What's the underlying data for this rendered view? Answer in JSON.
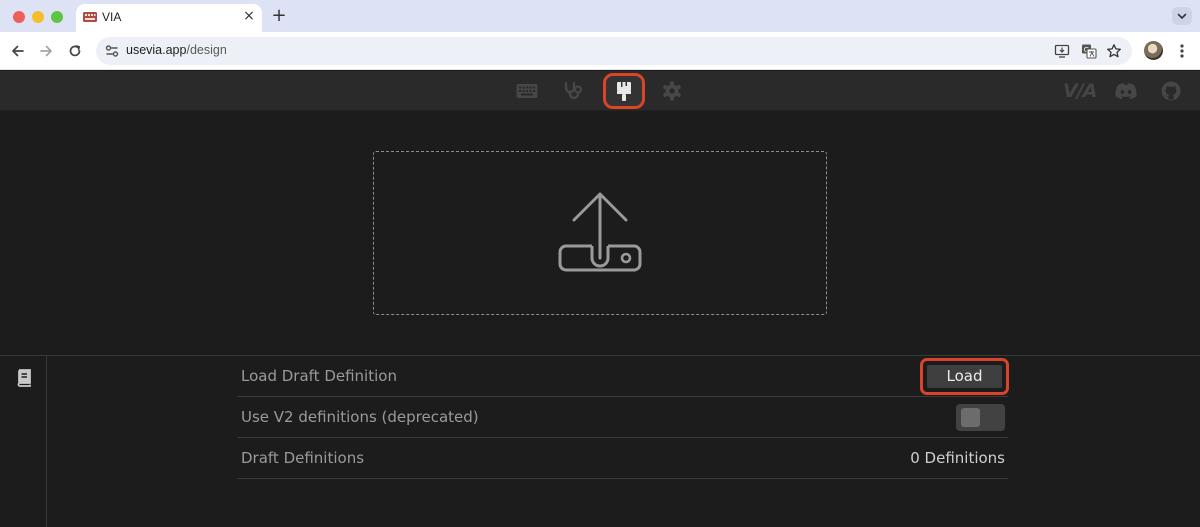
{
  "browser": {
    "tab_title": "VIA",
    "tab_close": "×",
    "new_tab": "+",
    "url_host": "usevia.app",
    "url_path": "/design"
  },
  "icons": {
    "nav": [
      "keyboard-icon",
      "stethoscope-icon",
      "paintbrush-icon",
      "gear-icon"
    ],
    "right": [
      "discord-icon",
      "github-icon"
    ],
    "upload": "upload-icon",
    "sidebar": "book-icon"
  },
  "app": {
    "logo": "V/A"
  },
  "settings": {
    "rows": [
      {
        "label": "Load Draft Definition",
        "button": "Load"
      },
      {
        "label": "Use V2 definitions (deprecated)",
        "toggle_on": false
      },
      {
        "label": "Draft Definitions",
        "value": "0 Definitions"
      }
    ]
  },
  "colors": {
    "background": "#1c1c1c",
    "nav_background": "#2a2a2a",
    "highlight": "#d9442a",
    "button": "#3f3f3f"
  }
}
